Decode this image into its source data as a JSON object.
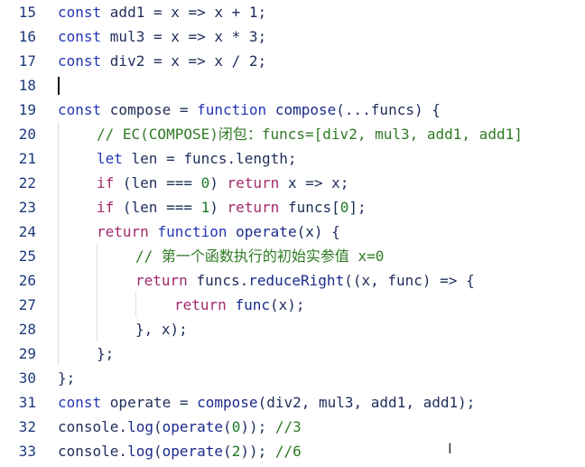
{
  "editor": {
    "lines": [
      {
        "n": "15",
        "tokens": [
          [
            "kw",
            "const "
          ],
          [
            "id",
            "add1 = x => x + 1;"
          ]
        ]
      },
      {
        "n": "16",
        "tokens": [
          [
            "kw",
            "const "
          ],
          [
            "id",
            "mul3 = x => x * 3;"
          ]
        ]
      },
      {
        "n": "17",
        "tokens": [
          [
            "kw",
            "const "
          ],
          [
            "id",
            "div2 = x => x / 2;"
          ]
        ]
      },
      {
        "n": "18",
        "tokens": []
      },
      {
        "n": "19",
        "tokens": [
          [
            "kw",
            "const "
          ],
          [
            "id",
            "compose = "
          ],
          [
            "kw",
            "function "
          ],
          [
            "fn",
            "compose"
          ],
          [
            "id",
            "(...funcs) {"
          ]
        ]
      },
      {
        "n": "20",
        "tokens": [
          [
            "cmt",
            "// EC(COMPOSE)闭包：funcs=[div2, mul3, add1, add1]"
          ]
        ]
      },
      {
        "n": "21",
        "tokens": [
          [
            "kw",
            "let "
          ],
          [
            "id",
            "len = funcs.length;"
          ]
        ]
      },
      {
        "n": "22",
        "tokens": [
          [
            "ctl",
            "if "
          ],
          [
            "id",
            "(len === "
          ],
          [
            "num",
            "0"
          ],
          [
            "id",
            ") "
          ],
          [
            "ctl",
            "return "
          ],
          [
            "id",
            "x => x;"
          ]
        ]
      },
      {
        "n": "23",
        "tokens": [
          [
            "ctl",
            "if "
          ],
          [
            "id",
            "(len === "
          ],
          [
            "num",
            "1"
          ],
          [
            "id",
            ") "
          ],
          [
            "ctl",
            "return "
          ],
          [
            "id",
            "funcs["
          ],
          [
            "num",
            "0"
          ],
          [
            "id",
            "];"
          ]
        ]
      },
      {
        "n": "24",
        "tokens": [
          [
            "ctl",
            "return "
          ],
          [
            "kw",
            "function "
          ],
          [
            "fn",
            "operate"
          ],
          [
            "id",
            "(x) {"
          ]
        ]
      },
      {
        "n": "25",
        "tokens": [
          [
            "cmt",
            "// 第一个函数执行的初始实参值 x=0"
          ]
        ]
      },
      {
        "n": "26",
        "tokens": [
          [
            "ctl",
            "return "
          ],
          [
            "id",
            "funcs."
          ],
          [
            "fn",
            "reduceRight"
          ],
          [
            "id",
            "((x, func) => {"
          ]
        ]
      },
      {
        "n": "27",
        "tokens": [
          [
            "ctl",
            "return "
          ],
          [
            "fn",
            "func"
          ],
          [
            "id",
            "(x);"
          ]
        ]
      },
      {
        "n": "28",
        "tokens": [
          [
            "id",
            "}, x);"
          ]
        ]
      },
      {
        "n": "29",
        "tokens": [
          [
            "id",
            "};"
          ]
        ]
      },
      {
        "n": "30",
        "tokens": [
          [
            "id",
            "};"
          ]
        ]
      },
      {
        "n": "31",
        "tokens": [
          [
            "kw",
            "const "
          ],
          [
            "id",
            "operate = "
          ],
          [
            "fn",
            "compose"
          ],
          [
            "id",
            "(div2, mul3, add1, add1);"
          ]
        ]
      },
      {
        "n": "32",
        "tokens": [
          [
            "id",
            "console."
          ],
          [
            "fn",
            "log"
          ],
          [
            "id",
            "("
          ],
          [
            "fn",
            "operate"
          ],
          [
            "id",
            "("
          ],
          [
            "num",
            "0"
          ],
          [
            "id",
            "));"
          ],
          [
            "cmt",
            " //3"
          ]
        ]
      },
      {
        "n": "33",
        "tokens": [
          [
            "id",
            "console."
          ],
          [
            "fn",
            "log"
          ],
          [
            "id",
            "("
          ],
          [
            "fn",
            "operate"
          ],
          [
            "id",
            "("
          ],
          [
            "num",
            "2"
          ],
          [
            "id",
            "));"
          ],
          [
            "cmt",
            " //6"
          ]
        ]
      }
    ],
    "indents": [
      0,
      0,
      0,
      0,
      0,
      1,
      1,
      1,
      1,
      1,
      2,
      2,
      3,
      2,
      1,
      0,
      0,
      0,
      0
    ],
    "text_cursor_glyph": "I"
  }
}
